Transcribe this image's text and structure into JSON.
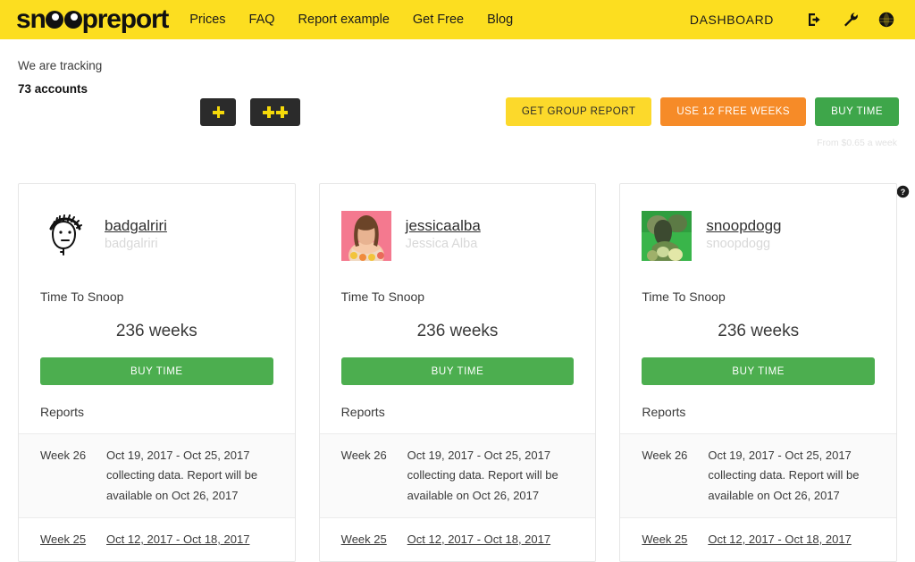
{
  "header": {
    "logo_pre": "sn",
    "logo_post": "preport",
    "nav": [
      {
        "label": "Prices"
      },
      {
        "label": "FAQ"
      },
      {
        "label": "Report example"
      },
      {
        "label": "Get Free"
      },
      {
        "label": "Blog"
      }
    ],
    "dashboard_label": "DASHBOARD",
    "icons": [
      {
        "name": "logout-icon"
      },
      {
        "name": "wrench-icon"
      },
      {
        "name": "globe-icon"
      }
    ],
    "colors": {
      "background": "#fcde20",
      "text": "#1b1b1b"
    }
  },
  "toolbar": {
    "tracking_label": "We are tracking",
    "tracking_count": "73 accounts",
    "add_one_label": "+",
    "add_many_label": "++",
    "buttons": [
      {
        "label": "GET GROUP REPORT",
        "color": "#fcd92b"
      },
      {
        "label": "USE 12 FREE WEEKS",
        "color": "#f68b28"
      },
      {
        "label": "BUY TIME",
        "color": "#3ea64a"
      }
    ],
    "fineprint": "From $0.65 a week",
    "help_icon": "help-circle-icon"
  },
  "cards": [
    {
      "username": "badgalriri",
      "realname": "badgalriri",
      "avatar_type": "doodle-face",
      "time_to_snoop_label": "Time To Snoop",
      "weeks": "236 weeks",
      "buy_label": "BUY TIME",
      "reports_label": "Reports",
      "reports": [
        {
          "week": "Week 26",
          "range": "Oct 19, 2017 - Oct 25, 2017",
          "status_line1": "collecting data. Report will be",
          "status_line2": "available on Oct 26, 2017",
          "is_link": false
        },
        {
          "week": "Week 25",
          "range": "Oct 12, 2017 - Oct 18, 2017",
          "is_link": true
        }
      ]
    },
    {
      "username": "jessicaalba",
      "realname": "Jessica Alba",
      "avatar_type": "photo-pink",
      "time_to_snoop_label": "Time To Snoop",
      "weeks": "236 weeks",
      "buy_label": "BUY TIME",
      "reports_label": "Reports",
      "reports": [
        {
          "week": "Week 26",
          "range": "Oct 19, 2017 - Oct 25, 2017",
          "status_line1": "collecting data. Report will be",
          "status_line2": "available on Oct 26, 2017",
          "is_link": false
        },
        {
          "week": "Week 25",
          "range": "Oct 12, 2017 - Oct 18, 2017",
          "is_link": true
        }
      ]
    },
    {
      "username": "snoopdogg",
      "realname": "snoopdogg",
      "avatar_type": "photo-green",
      "time_to_snoop_label": "Time To Snoop",
      "weeks": "236 weeks",
      "buy_label": "BUY TIME",
      "reports_label": "Reports",
      "reports": [
        {
          "week": "Week 26",
          "range": "Oct 19, 2017 - Oct 25, 2017",
          "status_line1": "collecting data. Report will be",
          "status_line2": "available on Oct 26, 2017",
          "is_link": false
        },
        {
          "week": "Week 25",
          "range": "Oct 12, 2017 - Oct 18, 2017",
          "is_link": true
        }
      ]
    }
  ]
}
